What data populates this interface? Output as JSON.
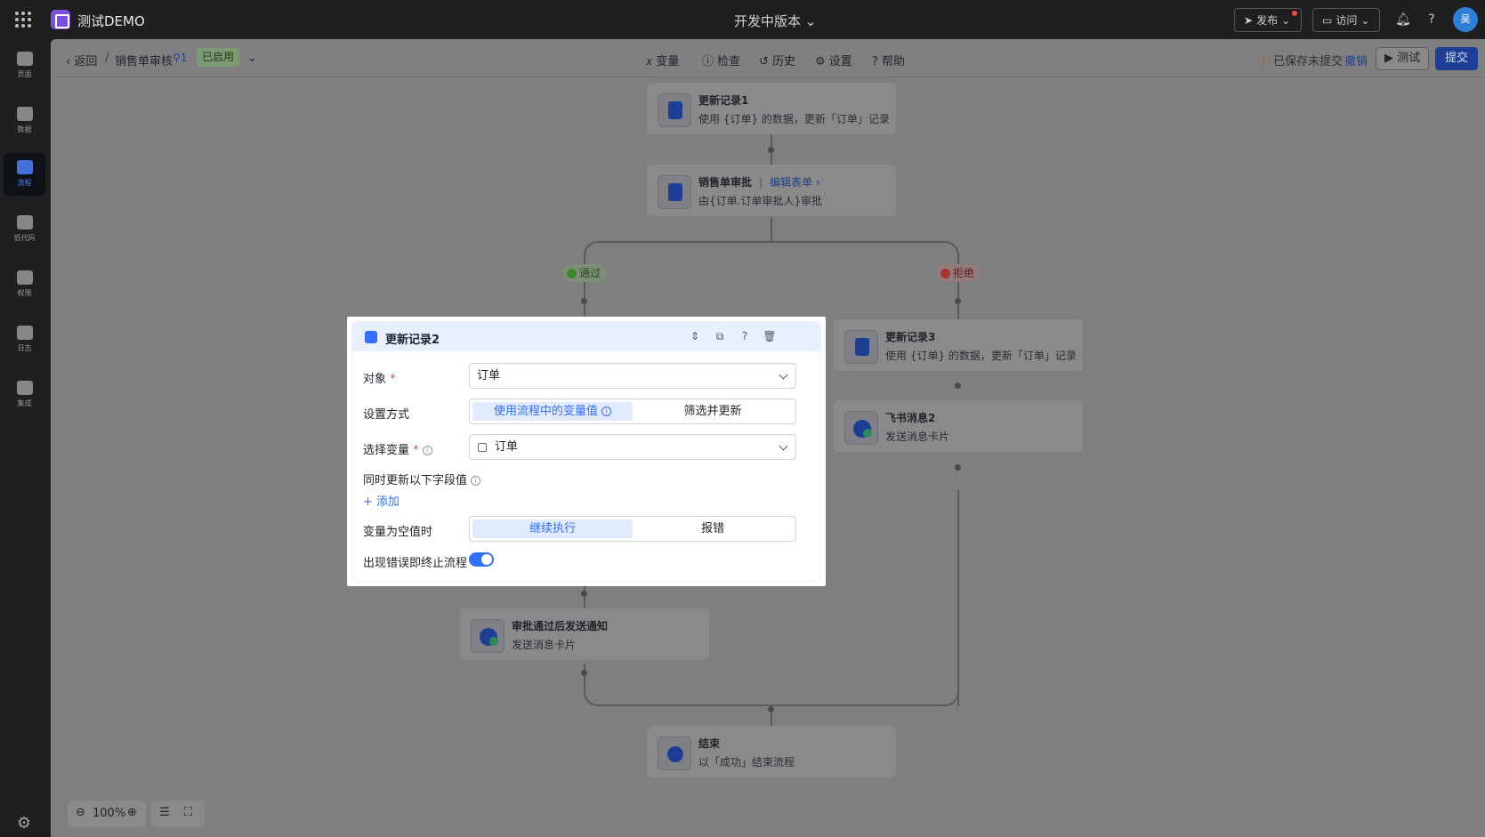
{
  "header": {
    "app_name": "测试DEMO",
    "version": "开发中版本",
    "publish": "发布",
    "visit": "访问",
    "avatar": "吴"
  },
  "sidebar": {
    "items": [
      {
        "label": "页面"
      },
      {
        "label": "数据"
      },
      {
        "label": "流程"
      },
      {
        "label": "低代码"
      },
      {
        "label": "权限"
      },
      {
        "label": "日志"
      },
      {
        "label": "集成"
      }
    ]
  },
  "subbar": {
    "back": "返回",
    "separator": "/",
    "flow_name": "销售单审核",
    "version_count": "1",
    "status": "已启用",
    "variables": "变量",
    "check": "检查",
    "history": "历史",
    "settings": "设置",
    "help": "帮助",
    "saved_status": "已保存未提交",
    "undo": "撤销",
    "test": "测试",
    "submit": "提交"
  },
  "flow": {
    "nodes": {
      "update1": {
        "title": "更新记录1",
        "desc": "使用 {订单} 的数据，更新「订单」记录"
      },
      "approval": {
        "title": "销售单审批",
        "edit_form": "编辑表单",
        "desc": "由{订单.订单审批人}审批"
      },
      "update3": {
        "title": "更新记录3",
        "desc": "使用 {订单} 的数据，更新「订单」记录"
      },
      "lark2": {
        "title": "飞书消息2",
        "desc": "发送消息卡片"
      },
      "notify": {
        "title": "审批通过后发送通知",
        "desc": "发送消息卡片"
      },
      "end": {
        "title": "结束",
        "desc": "以「成功」结束流程"
      }
    },
    "branch_pass": "通过",
    "branch_reject": "拒绝"
  },
  "zoom": {
    "level": "100%"
  },
  "panel": {
    "title": "更新记录2",
    "object_label": "对象",
    "object_value": "订单",
    "mode_label": "设置方式",
    "mode_options": [
      "使用流程中的变量值",
      "筛选并更新"
    ],
    "variable_label": "选择变量",
    "variable_value": "订单",
    "fields_label": "同时更新以下字段值",
    "add": "添加",
    "empty_label": "变量为空值时",
    "empty_options": [
      "继续执行",
      "报错"
    ],
    "stop_on_error_label": "出现错误即终止流程",
    "stop_on_error": true
  }
}
